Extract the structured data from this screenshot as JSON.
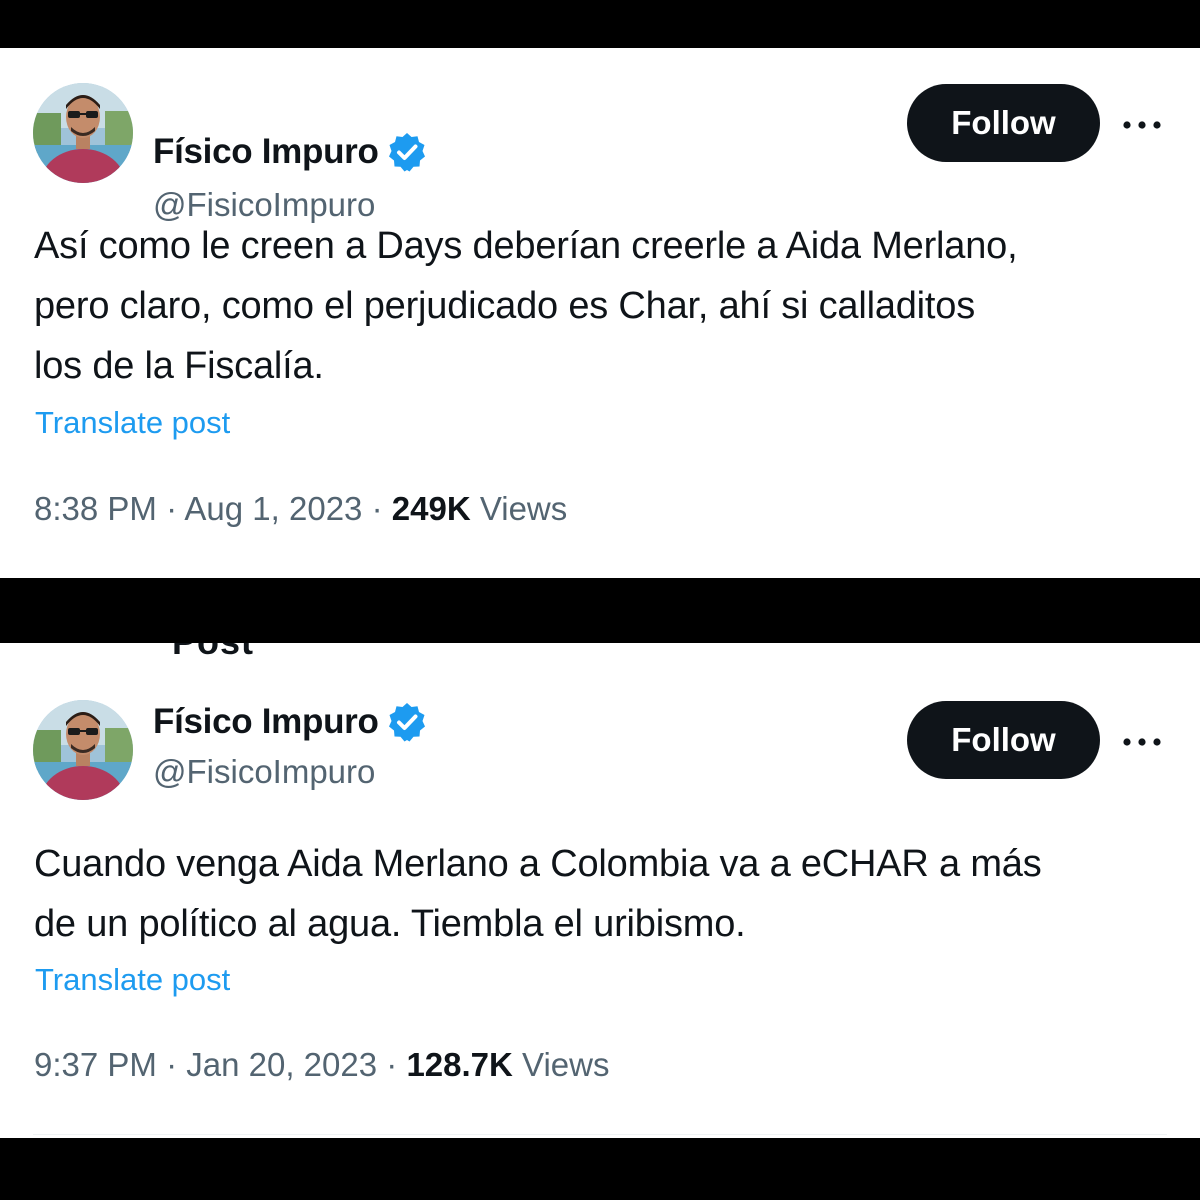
{
  "colors": {
    "background": "#000000",
    "card": "#ffffff",
    "text_primary": "#0f1419",
    "text_secondary": "#536471",
    "link": "#1d9bf0",
    "verified_badge": "#1d9bf0",
    "follow_button_bg": "#0f1419"
  },
  "second_panel_peek_text": "Post",
  "posts": [
    {
      "author": {
        "display_name": "Físico Impuro",
        "handle": "@FisicoImpuro",
        "verified": true,
        "avatar_icon": "profile-photo"
      },
      "follow_label": "Follow",
      "more_icon": "ellipsis-icon",
      "text_lines": [
        "Así como le creen a Days deberían creerle a Aida Merlano,",
        "pero claro, como el perjudicado es Char, ahí si calladitos",
        "los de la Fiscalía."
      ],
      "translate_label": "Translate post",
      "time": "8:38 PM",
      "date": "Aug 1, 2023",
      "views_count": "249K",
      "views_label": "Views"
    },
    {
      "author": {
        "display_name": "Físico Impuro",
        "handle": "@FisicoImpuro",
        "verified": true,
        "avatar_icon": "profile-photo"
      },
      "follow_label": "Follow",
      "more_icon": "ellipsis-icon",
      "text_lines": [
        "Cuando venga Aida Merlano a Colombia va a eCHAR a más",
        "de un político al agua. Tiembla el uribismo."
      ],
      "translate_label": "Translate post",
      "time": "9:37 PM",
      "date": "Jan 20, 2023",
      "views_count": "128.7K",
      "views_label": "Views"
    }
  ]
}
